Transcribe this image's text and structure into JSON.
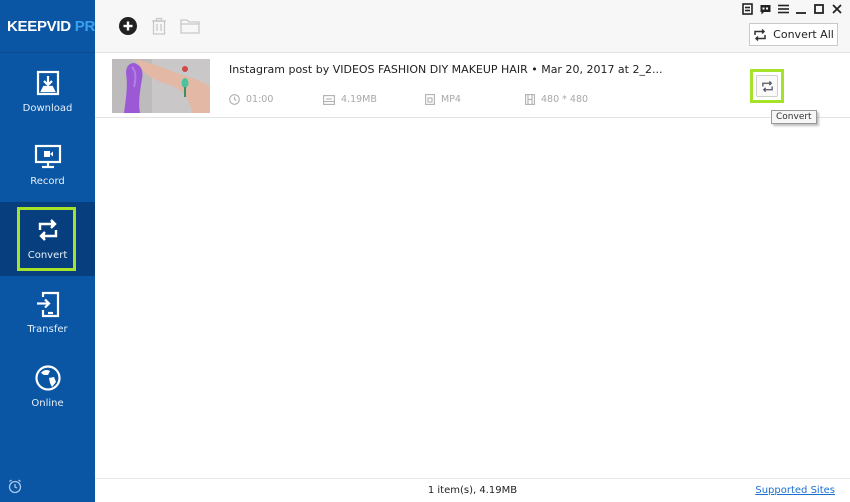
{
  "app": {
    "logo_main": "KEEPVID",
    "logo_accent": "PRO"
  },
  "sidebar": {
    "items": [
      {
        "label": "Download",
        "icon": "download-icon",
        "active": false
      },
      {
        "label": "Record",
        "icon": "record-screen-icon",
        "active": false
      },
      {
        "label": "Convert",
        "icon": "convert-icon",
        "active": true
      },
      {
        "label": "Transfer",
        "icon": "transfer-icon",
        "active": false
      },
      {
        "label": "Online",
        "icon": "globe-icon",
        "active": false
      }
    ],
    "footer_icon": "alarm-clock-icon"
  },
  "toolbar": {
    "add_icon": "add-icon",
    "delete_icon": "trash-icon",
    "folder_icon": "folder-icon",
    "convert_all_label": "Convert All"
  },
  "window_controls": [
    "notes-icon",
    "feedback-icon",
    "menu-icon",
    "minimize-icon",
    "maximize-icon",
    "close-icon"
  ],
  "files": [
    {
      "title": "Instagram post by VIDEOS FASHION DIY MAKEUP HAIR • Mar 20, 2017 at 2_2...",
      "duration": "01:00",
      "size": "4.19MB",
      "format": "MP4",
      "resolution": "480 * 480",
      "convert_tooltip": "Convert"
    }
  ],
  "status": {
    "summary": "1 item(s), 4.19MB",
    "link": "Supported Sites"
  },
  "colors": {
    "sidebar": "#0a55a4",
    "sidebar_active": "#073f7e",
    "highlight": "#a6e22a",
    "link": "#1a6fd1"
  }
}
